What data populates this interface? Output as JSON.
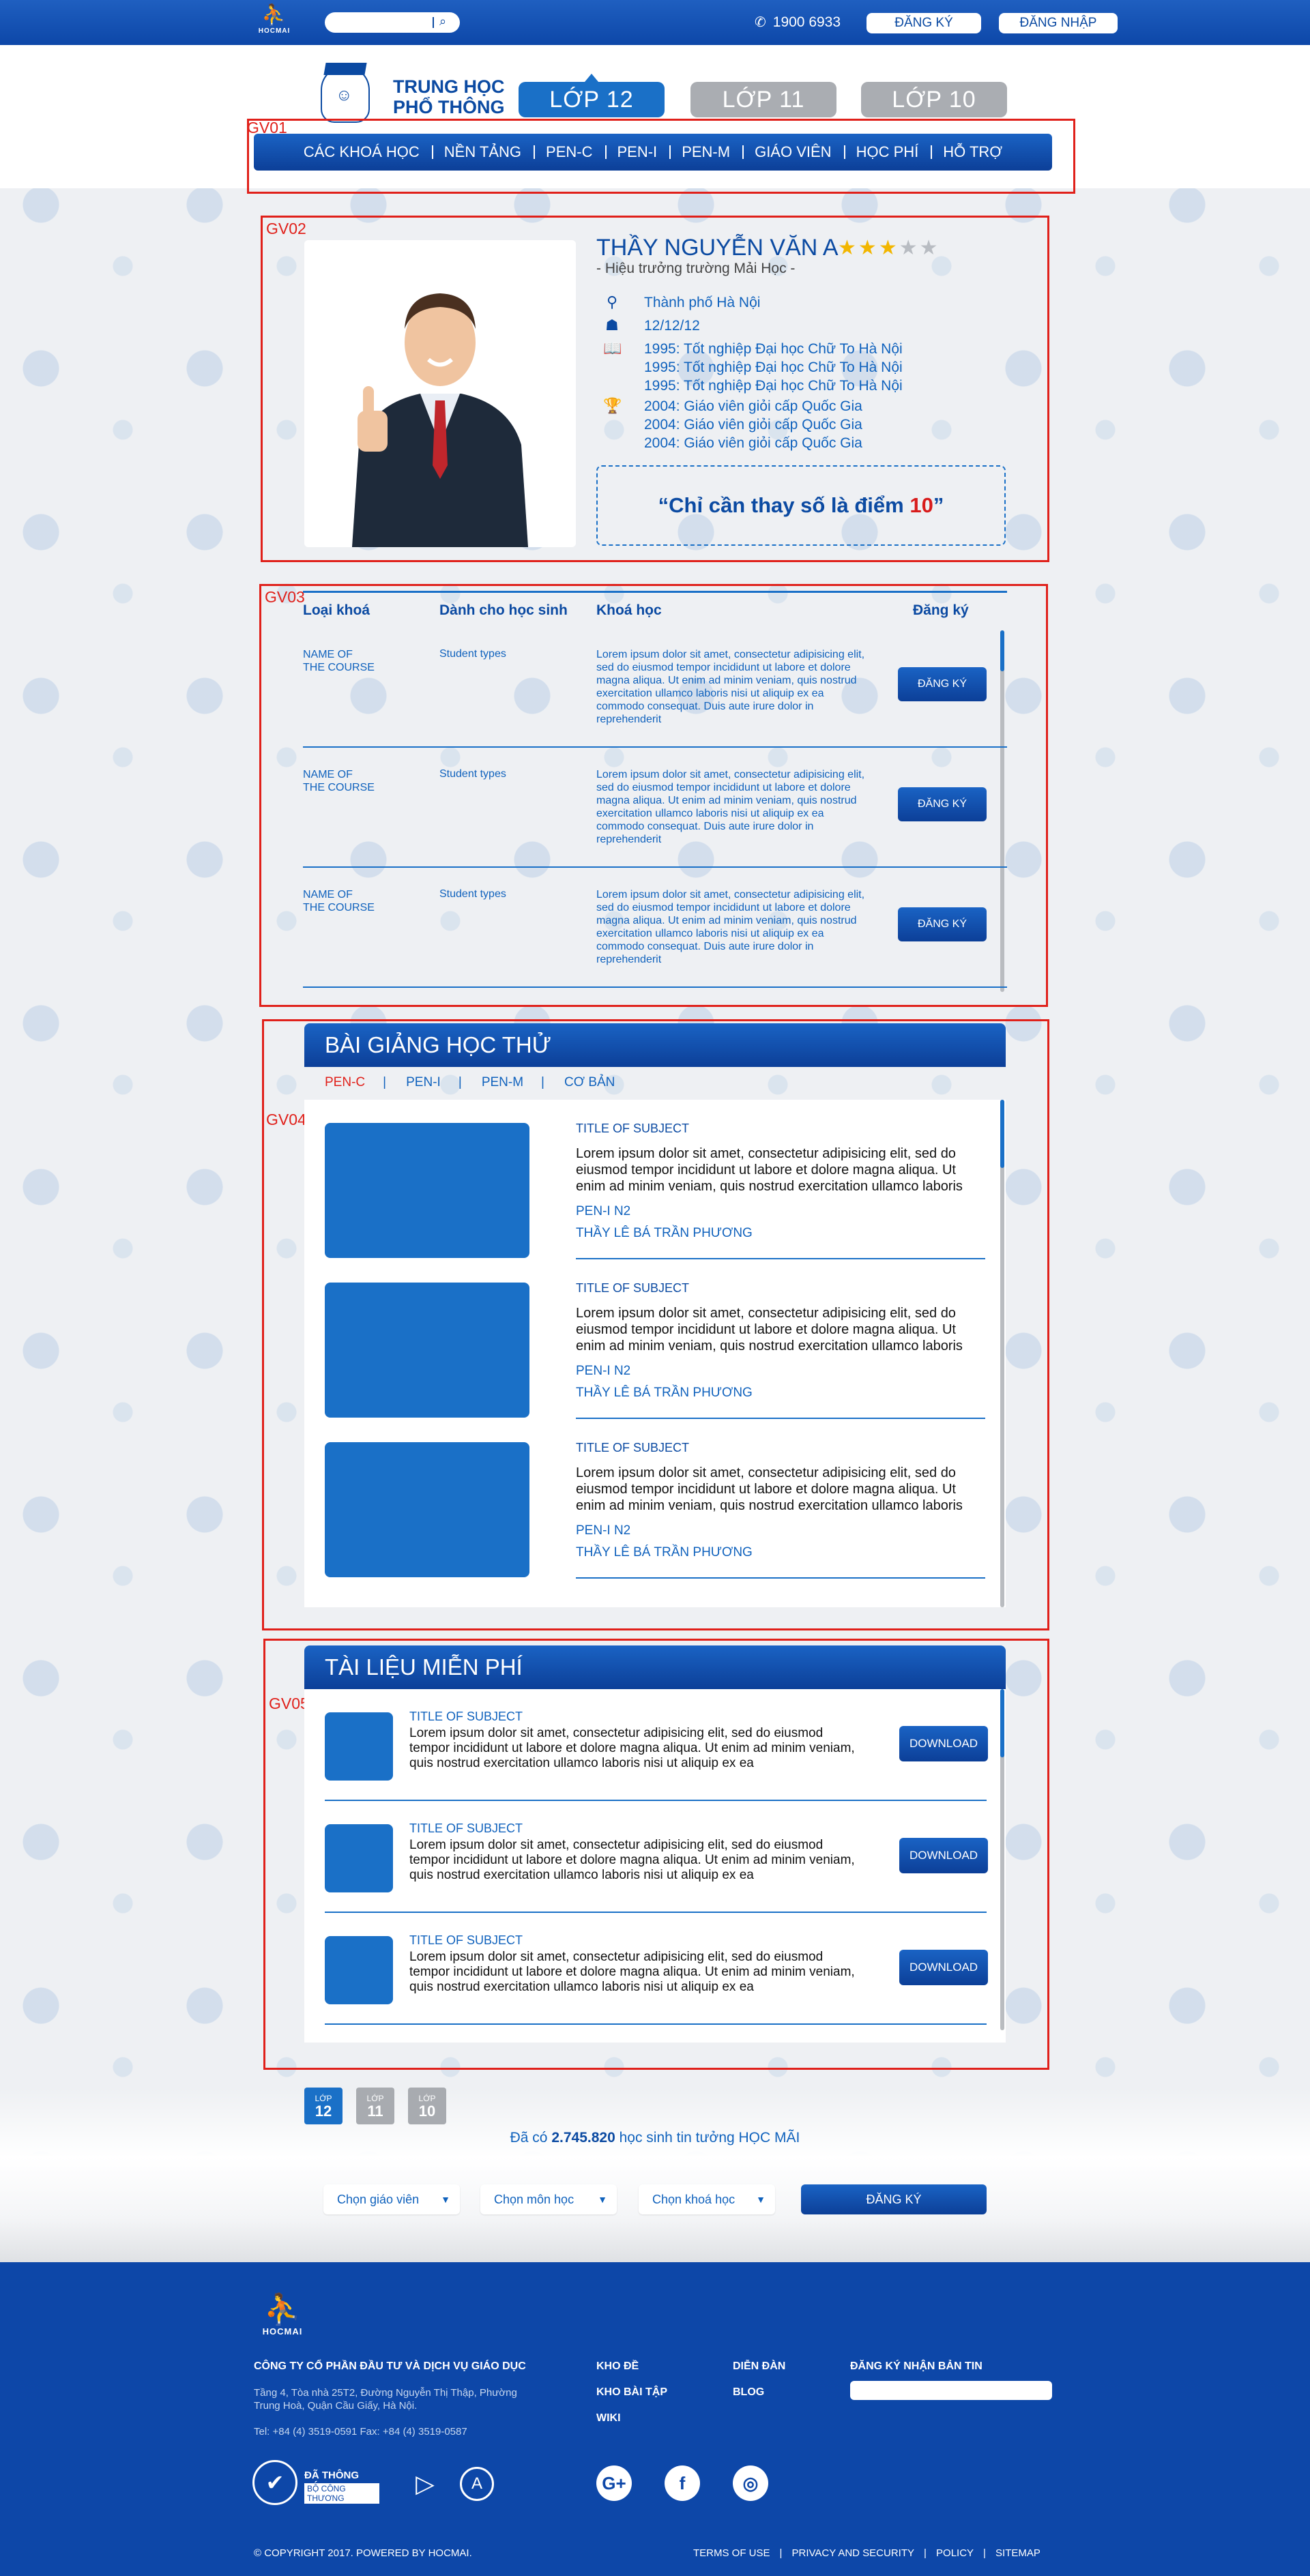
{
  "topbar": {
    "logo_text": "HOCMAI",
    "search_placeholder": "",
    "phone": "1900 6933",
    "signup_label": "ĐĂNG KÝ",
    "login_label": "ĐĂNG NHẬP"
  },
  "header": {
    "brand_line1": "TRUNG HỌC",
    "brand_line2": "PHỔ THÔNG",
    "grade_tabs": [
      "LỚP 12",
      "LỚP 11",
      "LỚP 10"
    ],
    "nav": [
      "CÁC KHOÁ HỌC",
      "NỀN TẢNG",
      "PEN-C",
      "PEN-I",
      "PEN-M",
      "GIÁO VIÊN",
      "HỌC PHÍ",
      "HỖ TRỢ"
    ]
  },
  "annotations": [
    "GV01",
    "GV02",
    "GV03",
    "GV04",
    "GV05"
  ],
  "teacher": {
    "name": "THẦY NGUYỄN VĂN A",
    "rating": 3,
    "rating_max": 5,
    "subtitle": "- Hiệu trưởng trường Mải Học -",
    "location": "Thành phố Hà Nội",
    "birthday": "12/12/12",
    "education": [
      "1995: Tốt nghiệp Đại học Chữ To Hà Nội",
      "1995: Tốt nghiệp Đại học Chữ To Hà Nội",
      "1995: Tốt nghiệp Đại học Chữ To Hà Nội"
    ],
    "awards": [
      "2004: Giáo viên giỏi cấp Quốc Gia",
      "2004: Giáo viên giỏi cấp Quốc Gia",
      "2004: Giáo viên giỏi cấp Quốc Gia"
    ],
    "quote_open": "“Chỉ cần thay số là điểm ",
    "quote_num": "10",
    "quote_close": "”"
  },
  "courses": {
    "headers": [
      "Loại khoá",
      "Dành cho học sinh",
      "Khoá học",
      "Đăng ký"
    ],
    "rows": [
      {
        "name": "NAME OF\nTHE COURSE",
        "type": "Student types",
        "desc": "Lorem ipsum dolor sit amet, consectetur adipisicing elit, sed do eiusmod tempor incididunt ut labore et dolore magna aliqua. Ut enim ad minim veniam, quis nostrud exercitation ullamco laboris nisi ut aliquip ex ea commodo consequat. Duis aute irure dolor in reprehenderit",
        "button": "ĐĂNG KÝ"
      },
      {
        "name": "NAME OF\nTHE COURSE",
        "type": "Student types",
        "desc": "Lorem ipsum dolor sit amet, consectetur adipisicing elit, sed do eiusmod tempor incididunt ut labore et dolore magna aliqua. Ut enim ad minim veniam, quis nostrud exercitation ullamco laboris nisi ut aliquip ex ea commodo consequat. Duis aute irure dolor in reprehenderit",
        "button": "ĐĂNG KÝ"
      },
      {
        "name": "NAME OF\nTHE COURSE",
        "type": "Student types",
        "desc": "Lorem ipsum dolor sit amet, consectetur adipisicing elit, sed do eiusmod tempor incididunt ut labore et dolore magna aliqua. Ut enim ad minim veniam, quis nostrud exercitation ullamco laboris nisi ut aliquip ex ea commodo consequat. Duis aute irure dolor in reprehenderit",
        "button": "ĐĂNG KÝ"
      }
    ]
  },
  "lectures": {
    "title": "BÀI GIẢNG HỌC THỬ",
    "tabs": [
      "PEN-C",
      "PEN-I",
      "PEN-M",
      "CƠ BẢN"
    ],
    "active_tab": 0,
    "items": [
      {
        "title": "TITLE OF SUBJECT",
        "desc": "Lorem ipsum dolor sit amet, consectetur adipisicing elit, sed do eiusmod tempor incididunt ut labore et dolore magna aliqua. Ut enim ad minim veniam, quis nostrud exercitation ullamco laboris",
        "pen": "PEN-I N2",
        "teacher": "THẦY LÊ BÁ TRẦN PHƯƠNG"
      },
      {
        "title": "TITLE OF SUBJECT",
        "desc": "Lorem ipsum dolor sit amet, consectetur adipisicing elit, sed do eiusmod tempor incididunt ut labore et dolore magna aliqua. Ut enim ad minim veniam, quis nostrud exercitation ullamco laboris",
        "pen": "PEN-I N2",
        "teacher": "THẦY LÊ BÁ TRẦN PHƯƠNG"
      },
      {
        "title": "TITLE OF SUBJECT",
        "desc": "Lorem ipsum dolor sit amet, consectetur adipisicing elit, sed do eiusmod tempor incididunt ut labore et dolore magna aliqua. Ut enim ad minim veniam, quis nostrud exercitation ullamco laboris",
        "pen": "PEN-I N2",
        "teacher": "THẦY LÊ BÁ TRẦN PHƯƠNG"
      }
    ]
  },
  "documents": {
    "title": "TÀI LIỆU MIỄN PHÍ",
    "items": [
      {
        "title": "TITLE OF SUBJECT",
        "desc": "Lorem ipsum dolor sit amet, consectetur adipisicing elit, sed do eiusmod tempor incididunt ut labore et dolore magna aliqua. Ut enim ad minim veniam, quis nostrud exercitation ullamco laboris nisi ut aliquip ex ea",
        "button": "DOWNLOAD"
      },
      {
        "title": "TITLE OF SUBJECT",
        "desc": "Lorem ipsum dolor sit amet, consectetur adipisicing elit, sed do eiusmod tempor incididunt ut labore et dolore magna aliqua. Ut enim ad minim veniam, quis nostrud exercitation ullamco laboris nisi ut aliquip ex ea",
        "button": "DOWNLOAD"
      },
      {
        "title": "TITLE OF SUBJECT",
        "desc": "Lorem ipsum dolor sit amet, consectetur adipisicing elit, sed do eiusmod tempor incididunt ut labore et dolore magna aliqua. Ut enim ad minim veniam, quis nostrud exercitation ullamco laboris nisi ut aliquip ex ea",
        "button": "DOWNLOAD"
      }
    ]
  },
  "filter": {
    "mini_tabs": [
      {
        "label": "LỚP",
        "num": "12"
      },
      {
        "label": "LỚP",
        "num": "11"
      },
      {
        "label": "LỚP",
        "num": "10"
      }
    ],
    "trust_prefix": "Đã có ",
    "trust_count": "2.745.820",
    "trust_suffix": " học sinh tin tưởng HỌC MÃI",
    "select_teacher": "Chọn giáo viên",
    "select_subject": "Chọn môn học",
    "select_course": "Chọn khoá học",
    "submit": "ĐĂNG KÝ"
  },
  "footer": {
    "logo_text": "HOCMAI",
    "company": "CÔNG TY CỔ PHẦN ĐẦU TƯ VÀ DỊCH VỤ GIÁO DỤC",
    "address": "Tầng 4, Tòa nhà 25T2, Đường Nguyễn Thị Thập, Phường Trung Hoà, Quận Cầu Giấy, Hà Nội.",
    "contact": "Tel: +84 (4) 3519-0591 Fax: +84 (4) 3519-0587",
    "cert_line1": "ĐÃ THÔNG BÁO",
    "cert_line2": "BỘ CÔNG THƯƠNG",
    "links": {
      "kho_de": "KHO ĐỀ",
      "kho_bai_tap": "KHO BÀI TẬP",
      "wiki": "WIKI",
      "dien_dan": "DIỄN ĐÀN",
      "blog": "BLOG"
    },
    "newsletter": "ĐĂNG KÝ NHẬN BẢN TIN",
    "copyright": "© COPYRIGHT 2017. POWERED BY HOCMAI.",
    "legal": [
      "TERMS OF USE",
      "PRIVACY AND SECURITY",
      "POLICY",
      "SITEMAP"
    ]
  },
  "colors": {
    "primary": "#0d47a8",
    "accent": "#1a70c7",
    "annotation": "#e0201a",
    "star": "#f2b600"
  }
}
